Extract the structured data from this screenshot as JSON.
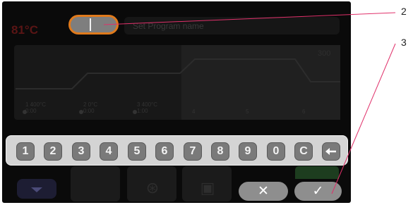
{
  "screen": {
    "temperature": "81°C",
    "name_field_text": "Set Program name",
    "graph_scale": "300",
    "graph_labels": [
      {
        "line1": "1 400°C",
        "line2": "0:00"
      },
      {
        "line1": "2 0°C",
        "line2": "0:00"
      },
      {
        "line1": "3 400°C",
        "line2": "1:00"
      },
      {
        "line1": "4",
        "line2": ""
      },
      {
        "line1": "5",
        "line2": ""
      },
      {
        "line1": "6",
        "line2": ""
      }
    ]
  },
  "keyboard": {
    "keys": [
      "1",
      "2",
      "3",
      "4",
      "5",
      "6",
      "7",
      "8",
      "9",
      "0",
      "C"
    ],
    "backspace_icon": "backspace-arrow-icon"
  },
  "bottom_bar": {
    "cancel_symbol": "✕",
    "confirm_symbol": "✓"
  },
  "callouts": {
    "input_field": "2",
    "confirm_button": "3"
  },
  "colors": {
    "focus_outline": "#e07a1c",
    "keypad_tray": "#d4d4d4",
    "key": "#7a7a7a",
    "leader_line": "#e0306a"
  }
}
